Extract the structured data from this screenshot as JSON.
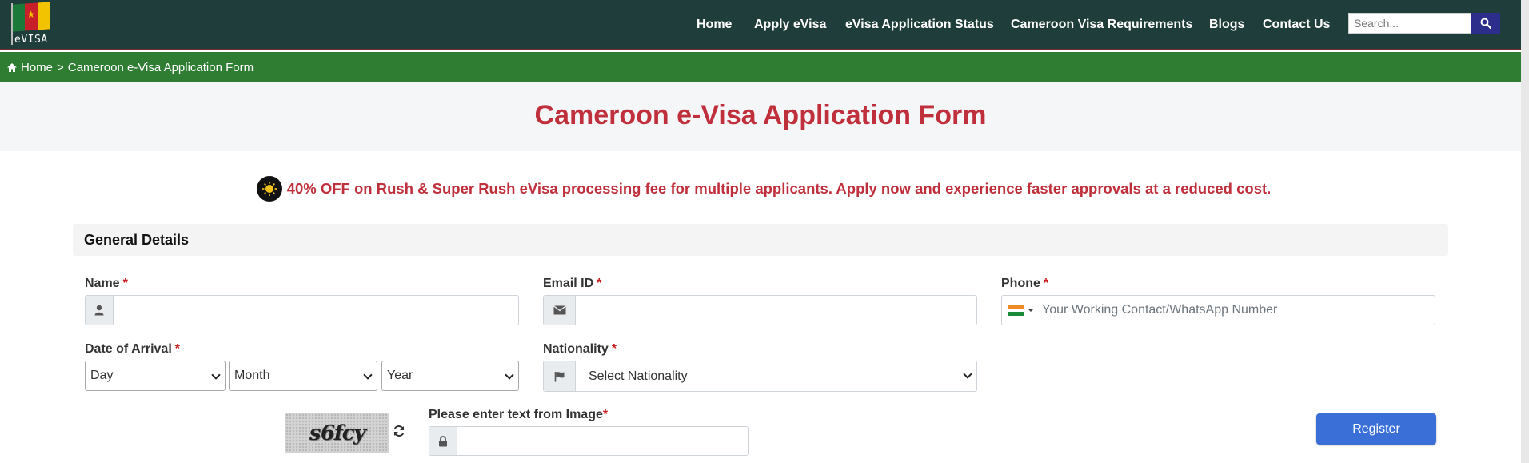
{
  "header": {
    "logo_text": "eVISA",
    "nav": [
      "Home",
      "Apply eVisa",
      "eVisa Application Status",
      "Cameroon Visa Requirements",
      "Blogs",
      "Contact Us"
    ],
    "search_placeholder": "Search..."
  },
  "breadcrumb": {
    "home": "Home",
    "separator": ">",
    "current": "Cameroon e-Visa Application Form"
  },
  "page_title": "Cameroon e-Visa Application Form",
  "promo": "40% OFF on Rush & Super Rush eVisa processing fee for multiple applicants. Apply now and experience faster approvals at a reduced cost.",
  "section": {
    "title": "General Details"
  },
  "form": {
    "name_label": "Name",
    "email_label": "Email ID",
    "phone_label": "Phone",
    "phone_placeholder": "Your Working Contact/WhatsApp Number",
    "arrival_label": "Date of Arrival",
    "day_option": "Day",
    "month_option": "Month",
    "year_option": "Year",
    "nationality_label": "Nationality",
    "nationality_option": "Select Nationality",
    "captcha_label": "Please enter text from Image",
    "captcha_text": "s6fcy",
    "required_mark": "*",
    "register_label": "Register"
  },
  "colors": {
    "navbar": "#1f3d3a",
    "breadcrumb": "#2e7d32",
    "title": "#c0303c",
    "register": "#3a6fd8"
  }
}
